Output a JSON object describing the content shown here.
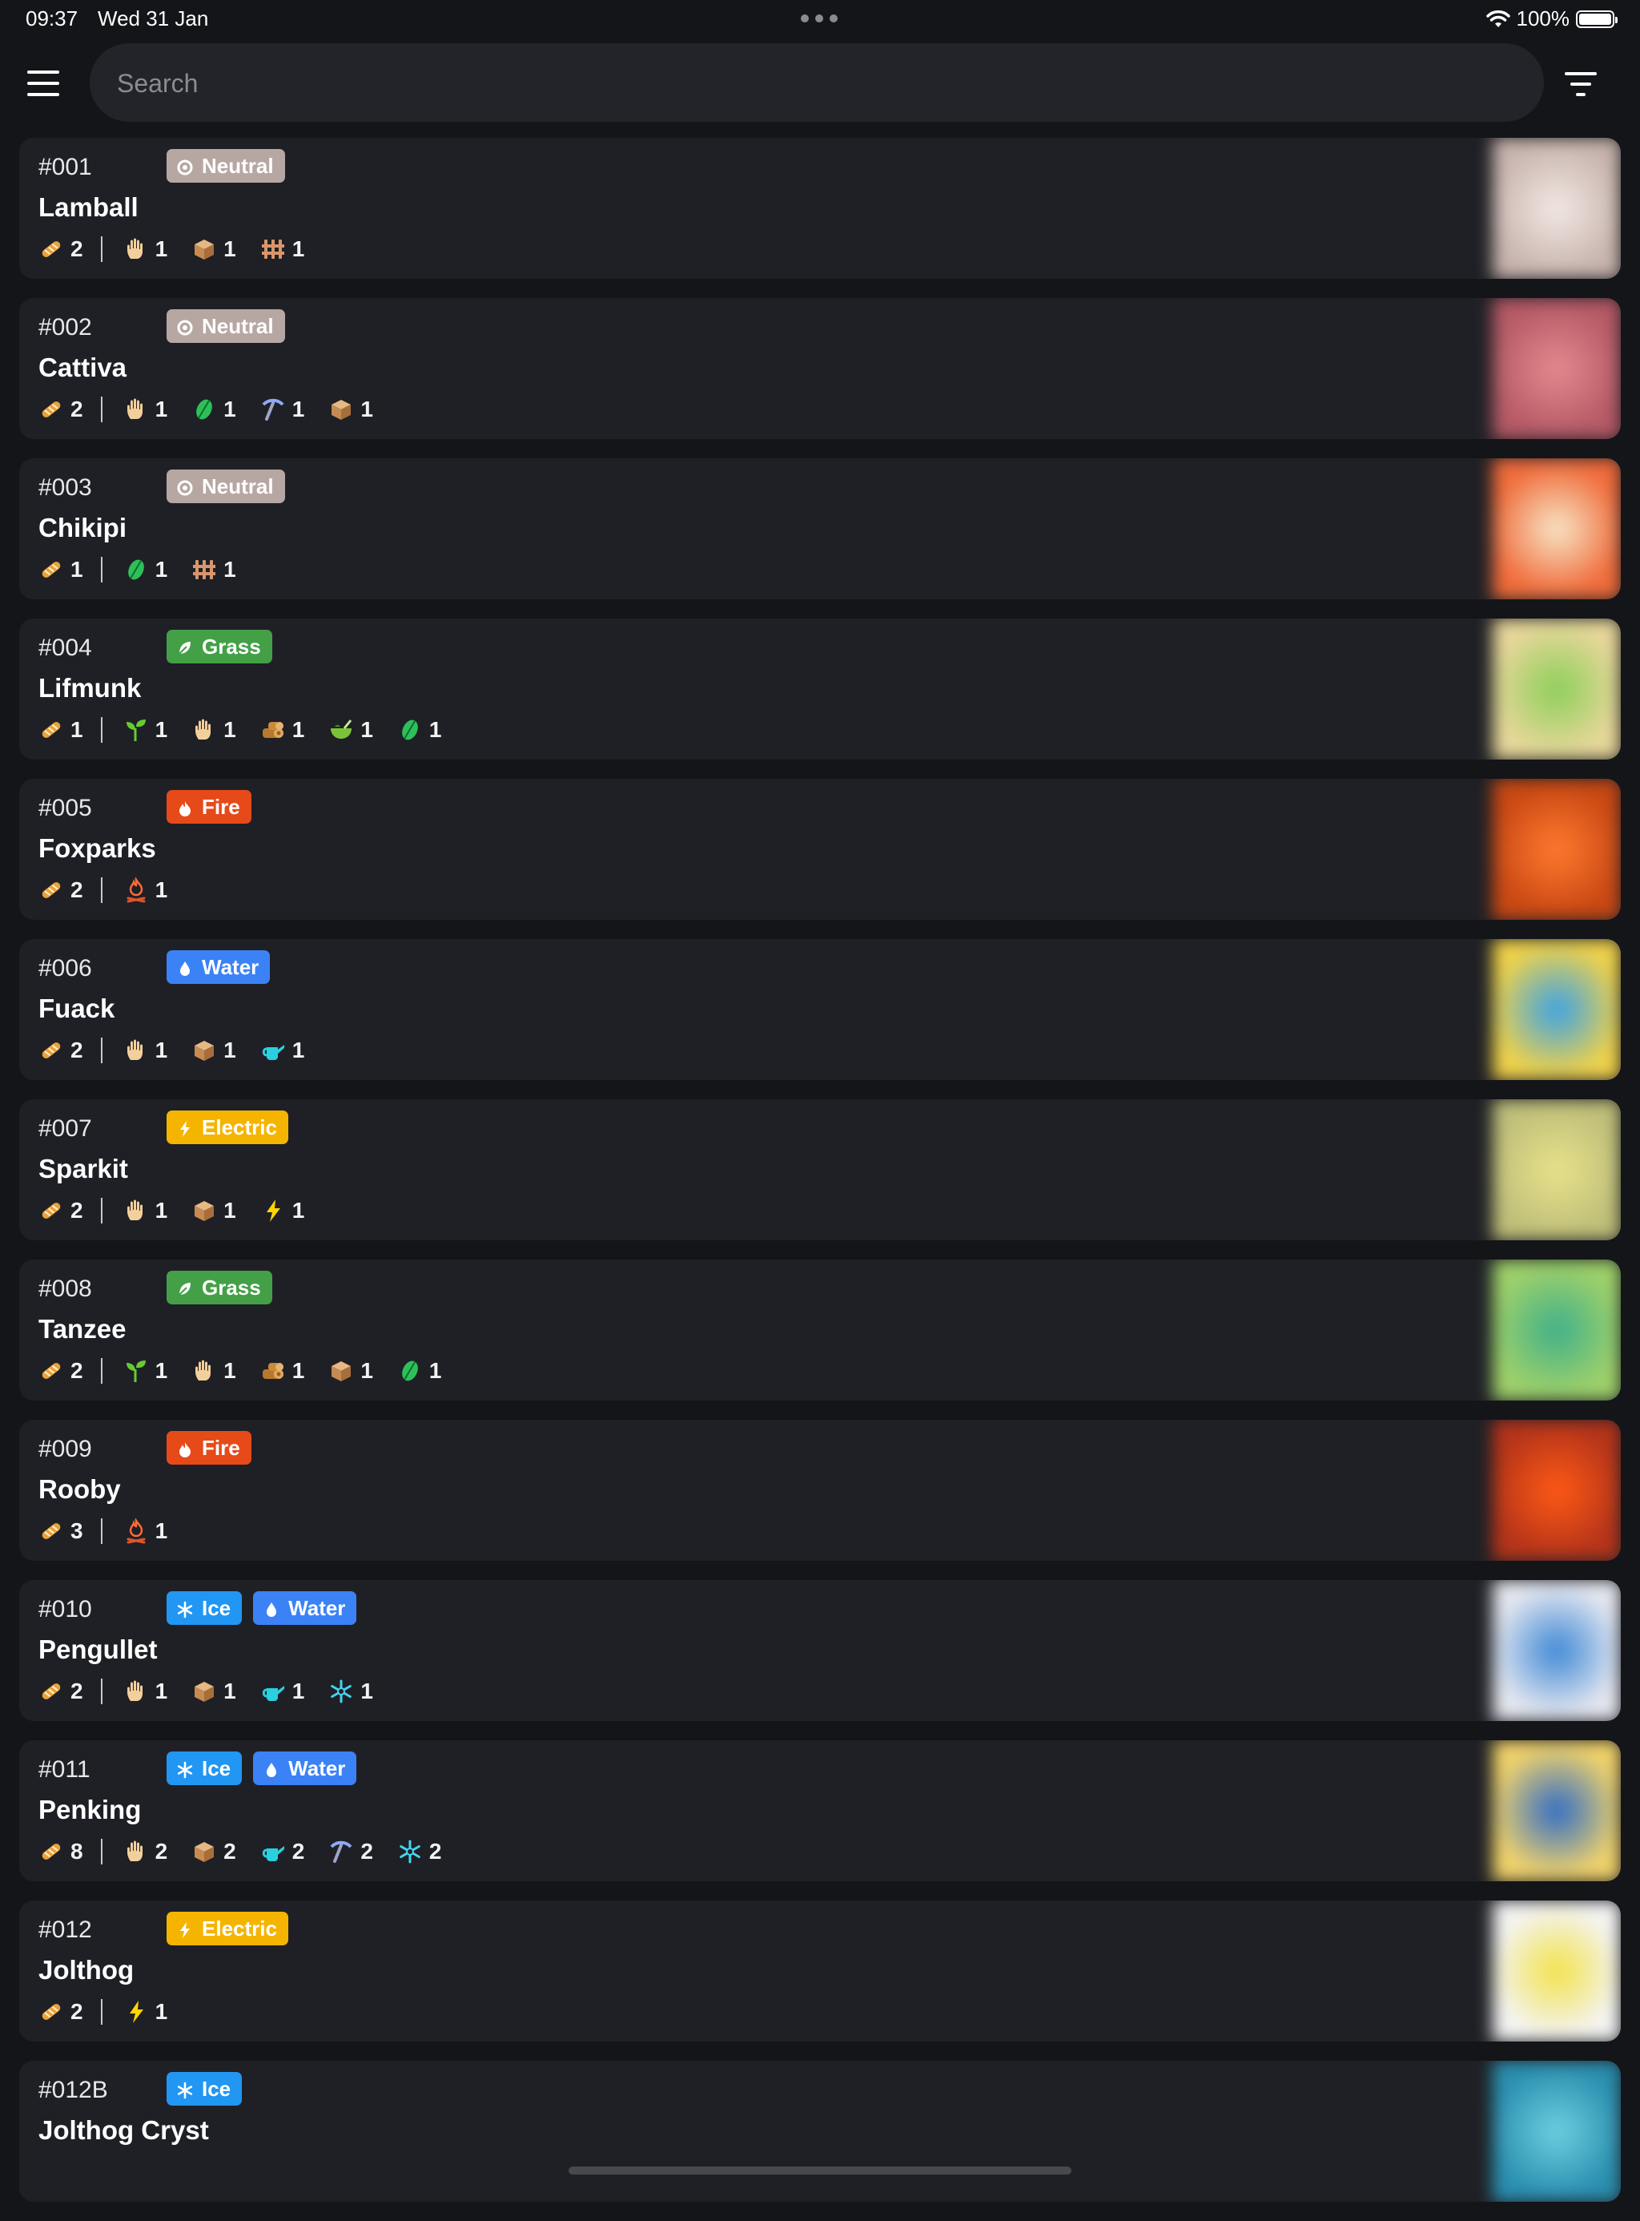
{
  "status_bar": {
    "time": "09:37",
    "date": "Wed 31 Jan",
    "battery": "100%"
  },
  "search": {
    "placeholder": "Search"
  },
  "colors": {
    "Neutral": "#b7a7a2",
    "Grass": "#43a047",
    "Fire": "#e64a19",
    "Water": "#3b82f6",
    "Electric": "#f5b400",
    "Ice": "#2196f3",
    "background": "#141519",
    "card": "#1f2025"
  },
  "pals": [
    {
      "number": "#001",
      "name": "Lamball",
      "types": [
        "Neutral"
      ],
      "food": "2",
      "work": [
        [
          "handiwork",
          "1"
        ],
        [
          "transporting",
          "1"
        ],
        [
          "farming",
          "1"
        ]
      ],
      "thumb": [
        "#f3e9e4",
        "#c8b4ae"
      ]
    },
    {
      "number": "#002",
      "name": "Cattiva",
      "types": [
        "Neutral"
      ],
      "food": "2",
      "work": [
        [
          "handiwork",
          "1"
        ],
        [
          "gathering",
          "1"
        ],
        [
          "mining",
          "1"
        ],
        [
          "transporting",
          "1"
        ]
      ],
      "thumb": [
        "#e48a8f",
        "#b65a66"
      ]
    },
    {
      "number": "#003",
      "name": "Chikipi",
      "types": [
        "Neutral"
      ],
      "food": "1",
      "work": [
        [
          "gathering",
          "1"
        ],
        [
          "farming",
          "1"
        ]
      ],
      "thumb": [
        "#f7e7c8",
        "#f06b3a"
      ]
    },
    {
      "number": "#004",
      "name": "Lifmunk",
      "types": [
        "Grass"
      ],
      "food": "1",
      "work": [
        [
          "planting",
          "1"
        ],
        [
          "handiwork",
          "1"
        ],
        [
          "lumbering",
          "1"
        ],
        [
          "medicine",
          "1"
        ],
        [
          "gathering",
          "1"
        ]
      ],
      "thumb": [
        "#8ccf5a",
        "#e8d79a"
      ]
    },
    {
      "number": "#005",
      "name": "Foxparks",
      "types": [
        "Fire"
      ],
      "food": "2",
      "work": [
        [
          "kindling",
          "1"
        ]
      ],
      "thumb": [
        "#ff7a2f",
        "#c94813"
      ]
    },
    {
      "number": "#006",
      "name": "Fuack",
      "types": [
        "Water"
      ],
      "food": "2",
      "work": [
        [
          "handiwork",
          "1"
        ],
        [
          "transporting",
          "1"
        ],
        [
          "watering",
          "1"
        ]
      ],
      "thumb": [
        "#3aa2e8",
        "#f0d24a"
      ]
    },
    {
      "number": "#007",
      "name": "Sparkit",
      "types": [
        "Electric"
      ],
      "food": "2",
      "work": [
        [
          "handiwork",
          "1"
        ],
        [
          "transporting",
          "1"
        ],
        [
          "electricity",
          "1"
        ]
      ],
      "thumb": [
        "#e8e28a",
        "#bfbf7a"
      ]
    },
    {
      "number": "#008",
      "name": "Tanzee",
      "types": [
        "Grass"
      ],
      "food": "2",
      "work": [
        [
          "planting",
          "1"
        ],
        [
          "handiwork",
          "1"
        ],
        [
          "lumbering",
          "1"
        ],
        [
          "transporting",
          "1"
        ],
        [
          "gathering",
          "1"
        ]
      ],
      "thumb": [
        "#3fb08a",
        "#9fd16a"
      ]
    },
    {
      "number": "#009",
      "name": "Rooby",
      "types": [
        "Fire"
      ],
      "food": "3",
      "work": [
        [
          "kindling",
          "1"
        ]
      ],
      "thumb": [
        "#ff5a14",
        "#b5341a"
      ]
    },
    {
      "number": "#010",
      "name": "Pengullet",
      "types": [
        "Ice",
        "Water"
      ],
      "food": "2",
      "work": [
        [
          "handiwork",
          "1"
        ],
        [
          "transporting",
          "1"
        ],
        [
          "watering",
          "1"
        ],
        [
          "cooling",
          "1"
        ]
      ],
      "thumb": [
        "#3e88d6",
        "#e6e8f0"
      ]
    },
    {
      "number": "#011",
      "name": "Penking",
      "types": [
        "Ice",
        "Water"
      ],
      "food": "8",
      "work": [
        [
          "handiwork",
          "2"
        ],
        [
          "transporting",
          "2"
        ],
        [
          "watering",
          "2"
        ],
        [
          "mining",
          "2"
        ],
        [
          "cooling",
          "2"
        ]
      ],
      "thumb": [
        "#2f6cc8",
        "#f2d36a"
      ]
    },
    {
      "number": "#012",
      "name": "Jolthog",
      "types": [
        "Electric"
      ],
      "food": "2",
      "work": [
        [
          "electricity",
          "1"
        ]
      ],
      "thumb": [
        "#f2e24a",
        "#f4f4f4"
      ]
    },
    {
      "number": "#012B",
      "name": "Jolthog Cryst",
      "types": [
        "Ice"
      ],
      "food": "",
      "work": [],
      "thumb": [
        "#6fd0e0",
        "#2a8fb0"
      ]
    }
  ]
}
